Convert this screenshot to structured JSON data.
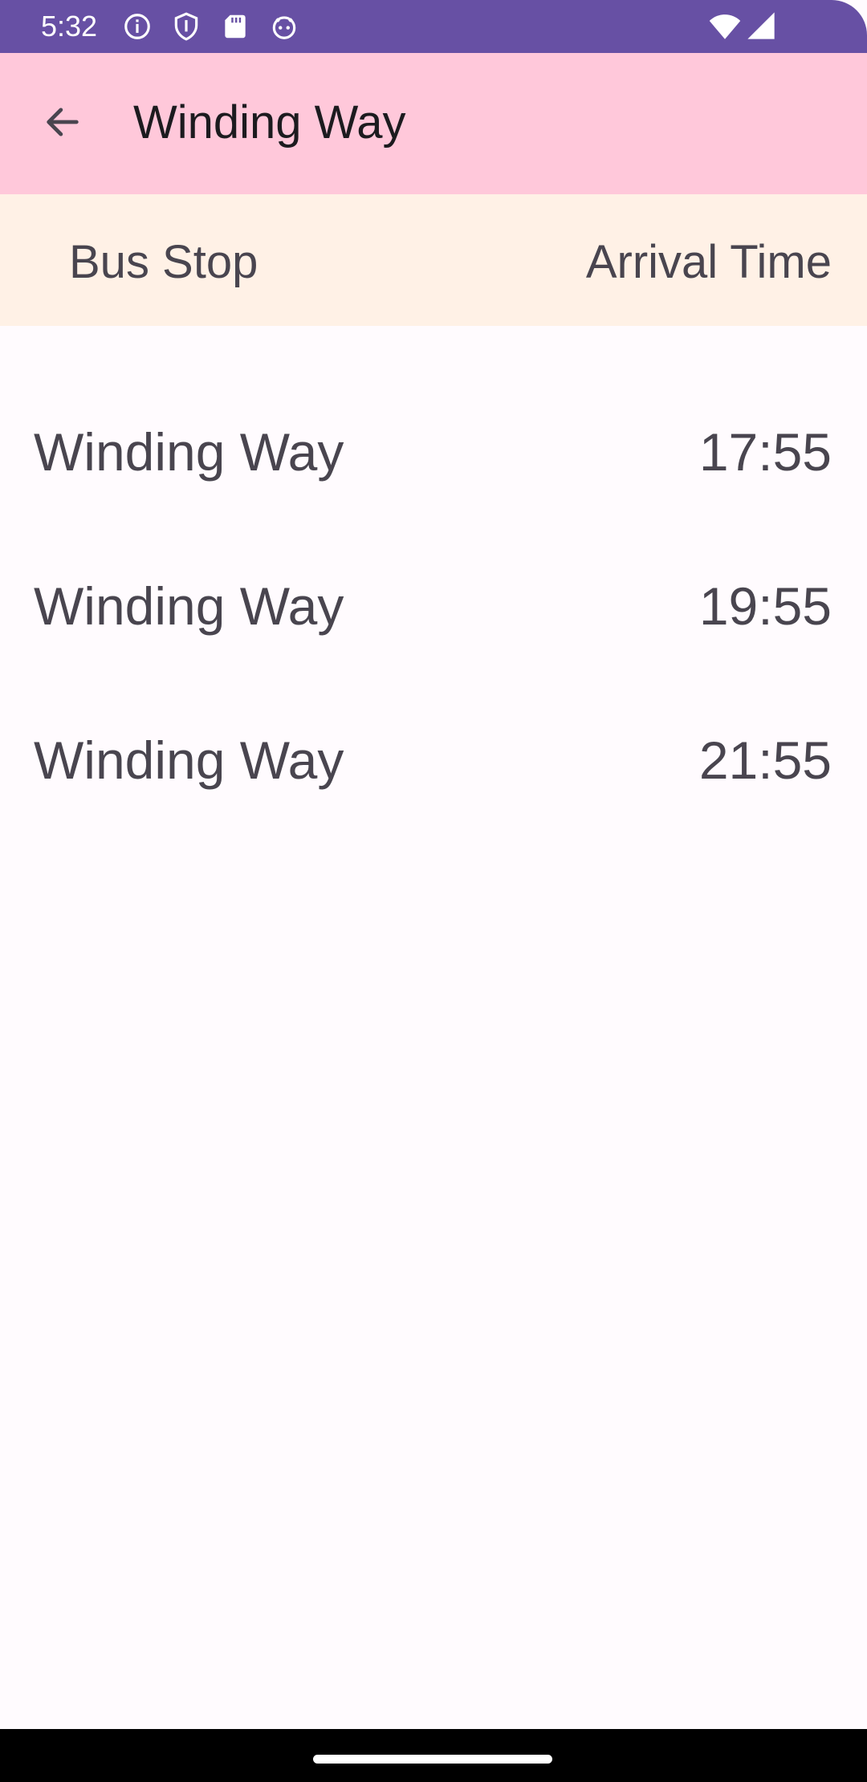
{
  "status_bar": {
    "time": "5:32",
    "icons": [
      "info-icon",
      "shield-icon",
      "sd-card-icon",
      "android-face-icon",
      "wifi-icon",
      "signal-icon"
    ],
    "color": "#6750a4"
  },
  "app_bar": {
    "back_icon": "arrow-back-icon",
    "title": "Winding Way",
    "color": "#ffc8da"
  },
  "table": {
    "header": {
      "stop_label": "Bus Stop",
      "time_label": "Arrival Time",
      "color": "#fff1e6"
    },
    "rows": [
      {
        "stop": "Winding Way",
        "time": "17:55"
      },
      {
        "stop": "Winding Way",
        "time": "19:55"
      },
      {
        "stop": "Winding Way",
        "time": "21:55"
      }
    ]
  }
}
